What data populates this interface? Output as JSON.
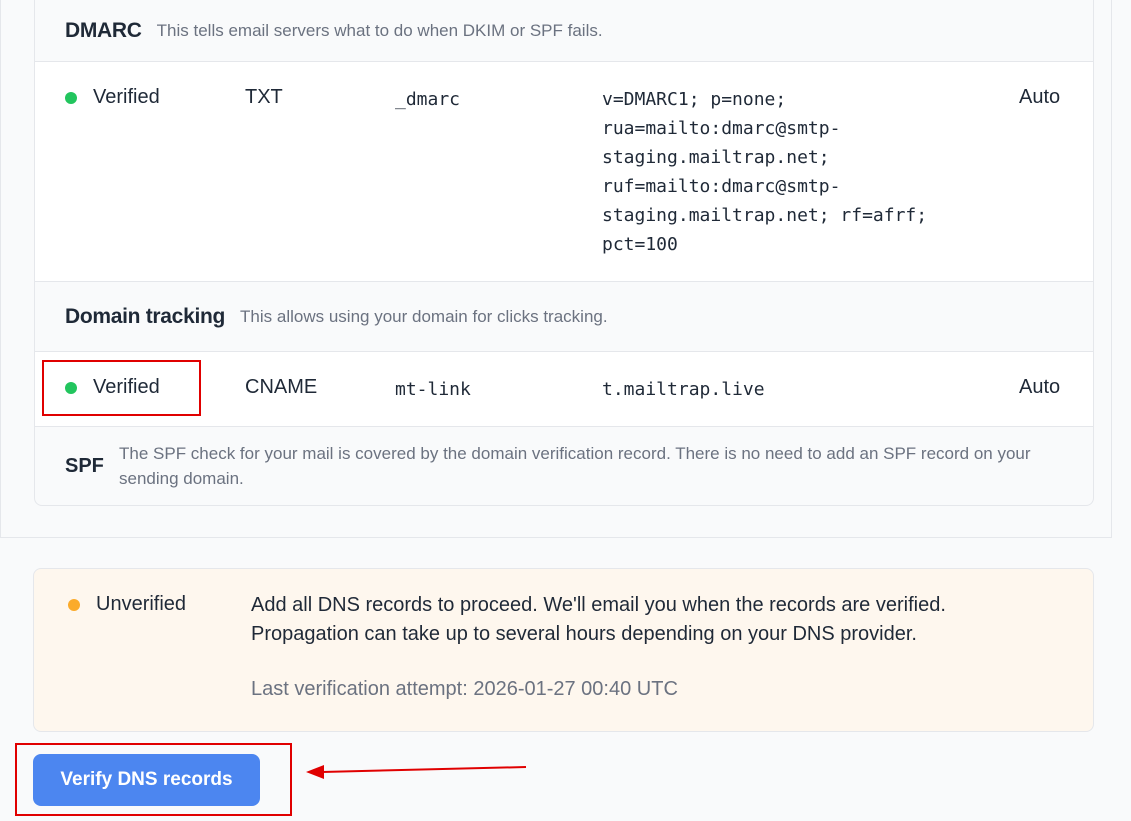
{
  "dmarc": {
    "title": "DMARC",
    "description": "This tells email servers what to do when DKIM or SPF fails.",
    "record": {
      "status": "Verified",
      "type": "TXT",
      "name": "_dmarc",
      "value": "v=DMARC1; p=none;\nrua=mailto:dmarc@smtp-\nstaging.mailtrap.net;\nruf=mailto:dmarc@smtp-\nstaging.mailtrap.net; rf=afrf;\npct=100",
      "ttl": "Auto"
    }
  },
  "tracking": {
    "title": "Domain tracking",
    "description": "This allows using your domain for clicks tracking.",
    "record": {
      "status": "Verified",
      "type": "CNAME",
      "name": "mt-link",
      "value": "t.mailtrap.live",
      "ttl": "Auto"
    }
  },
  "spf": {
    "label": "SPF",
    "description": "The SPF check for your mail is covered by the domain verification record. There is no need to add an SPF record on your sending domain."
  },
  "verification": {
    "status": "Unverified",
    "message_line1": "Add all DNS records to proceed. We'll email you when the records are verified.",
    "message_line2": "Propagation can take up to several hours depending on your DNS provider.",
    "last_attempt": "Last verification attempt: 2026-01-27 00:40 UTC"
  },
  "actions": {
    "verify_label": "Verify DNS records"
  },
  "colors": {
    "verified": "#22c55e",
    "unverified": "#fbab2b",
    "primary_button": "#4c86f0",
    "annotation": "#e00000"
  }
}
